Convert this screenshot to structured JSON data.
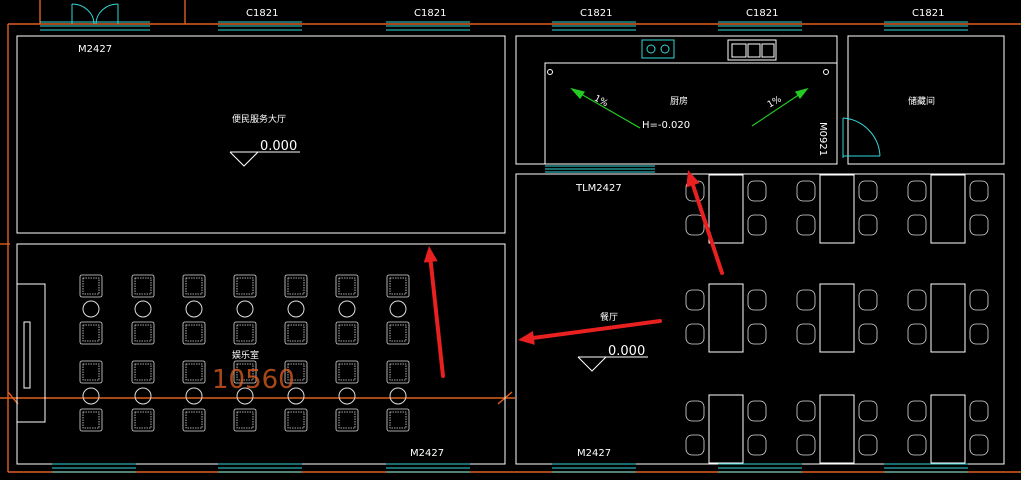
{
  "labels": {
    "window_c1821": "C1821",
    "door_m2427": "M2427",
    "door_m0921": "M0921",
    "door_tlm2427": "TLM2427",
    "room_service_hall": "便民服务大厅",
    "room_kitchen": "厨房",
    "room_storage": "储藏间",
    "room_dining": "餐厅",
    "room_recreation": "娱乐室",
    "elev_zero": "0.000",
    "elev_kitchen": "H=-0.020",
    "slope": "1%",
    "dimension": "10560"
  },
  "colors": {
    "background": "#000000",
    "wall": "#ffffff",
    "window": "#33d6d6",
    "outer_wall": "#e06020",
    "arrow": "#e82020",
    "slope_arrow": "#22cc22",
    "text": "#ffffff"
  },
  "icons": {
    "stove": "stove-icon",
    "sink": "sink-icon",
    "chair": "chair-icon",
    "table": "table-icon"
  }
}
